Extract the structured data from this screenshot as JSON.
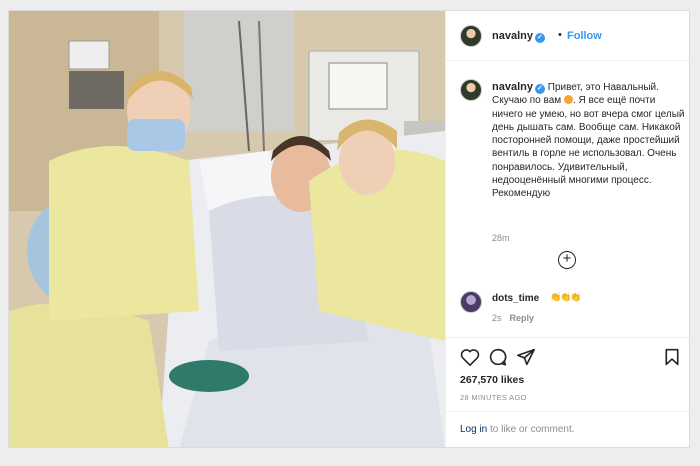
{
  "post": {
    "username": "navalny",
    "follow_label": "Follow",
    "separator": "•",
    "verified_glyph": "✓",
    "caption_pre": "Привет, это Навальный. Скучаю по вам ",
    "caption_post": ". Я все ещё почти ничего не умею, но вот вчера смог целый день дышать сам. Вообще сам. Никакой посторонней помощи, даже простейший вентиль в горле не использовал. Очень понравилось. Удивительный, недооценённый многими процесс. Рекомендую",
    "caption_time": "28m",
    "load_more_glyph": "+",
    "comment": {
      "username": "dots_time",
      "text": "👏👏👏",
      "time": "2s",
      "reply_label": "Reply"
    },
    "likes": "267,570 likes",
    "time_ago": "28 MINUTES AGO",
    "login_link": "Log in",
    "login_rest": " to like or comment."
  },
  "icons": [
    "heart-icon",
    "comment-icon",
    "share-icon",
    "bookmark-icon",
    "verified-badge-icon",
    "add-circle-icon"
  ],
  "colors": {
    "accent": "#3897f0",
    "text": "#262626",
    "muted": "#8e8e8e",
    "link": "#00376b"
  }
}
